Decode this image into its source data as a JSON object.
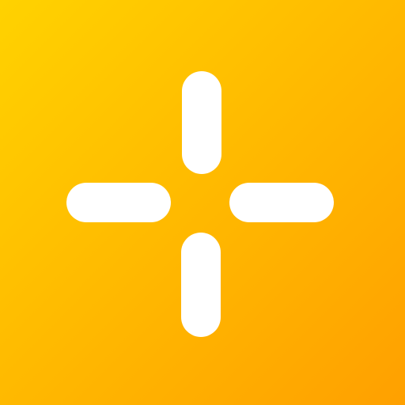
{
  "app_icon": {
    "name": "crosshair-icon",
    "colors": {
      "gradient_start": "#FFD200",
      "gradient_end": "#FFA000",
      "mark": "#FFFFFF"
    }
  }
}
